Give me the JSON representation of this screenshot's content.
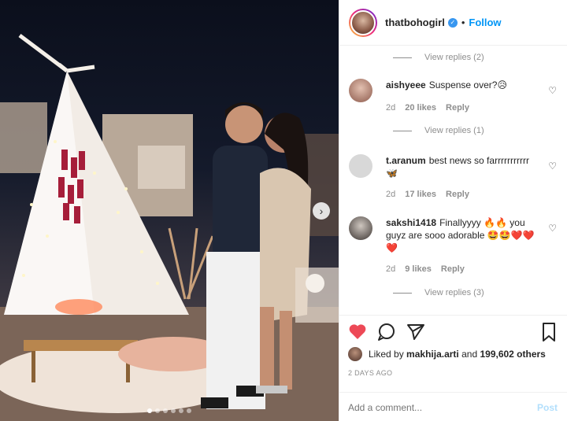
{
  "header": {
    "username": "thatbohogirl",
    "follow_label": "Follow",
    "separator": "•"
  },
  "replies": {
    "r1": "View replies (2)",
    "r2": "View replies (1)",
    "r3": "View replies (3)"
  },
  "comments": [
    {
      "user": "aishyeee",
      "text": "Suspense over?😥",
      "time": "2d",
      "likes": "20 likes",
      "reply": "Reply"
    },
    {
      "user": "t.aranum",
      "text": "best news so farrrrrrrrrrr 🦋",
      "time": "2d",
      "likes": "17 likes",
      "reply": "Reply"
    },
    {
      "user": "sakshi1418",
      "text": "Finallyyyy 🔥🔥 you guyz are sooo adorable 🤩🤩❤️❤️❤️",
      "time": "2d",
      "likes": "9 likes",
      "reply": "Reply"
    }
  ],
  "likes": {
    "prefix": "Liked by",
    "user": "makhija.arti",
    "conj": "and",
    "count": "199,602 others"
  },
  "timestamp": "2 DAYS AGO",
  "add_comment": {
    "placeholder": "Add a comment...",
    "post_label": "Post"
  },
  "colors": {
    "like_red": "#ed4956",
    "link_blue": "#0095f6",
    "muted": "#8e8e8e"
  },
  "icons": [
    "verified-badge-icon",
    "heart-icon",
    "comment-icon",
    "share-icon",
    "bookmark-icon",
    "chevron-right-icon"
  ],
  "carousel": {
    "total": 6,
    "active": 1
  }
}
